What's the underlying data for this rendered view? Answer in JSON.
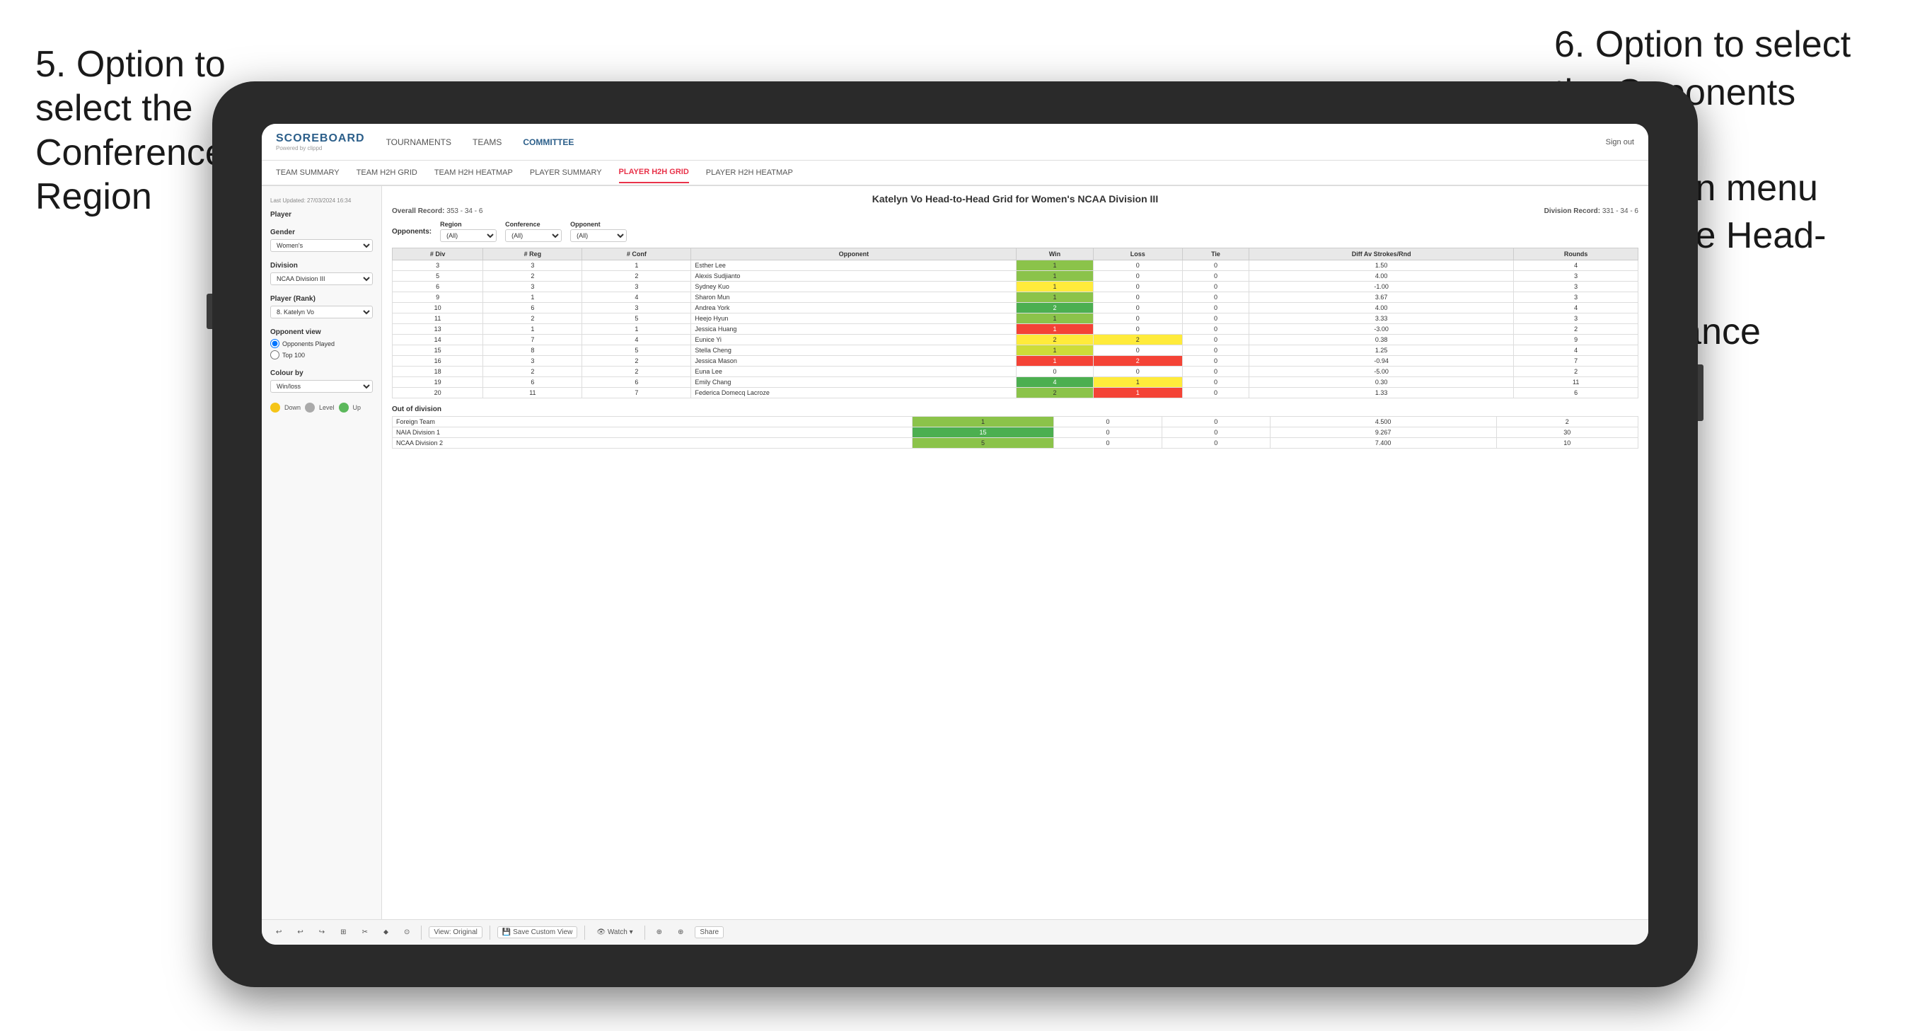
{
  "annotations": {
    "left": {
      "number": "5.",
      "text": "Option to\nselect the\nConference and\nRegion"
    },
    "right": {
      "number": "6.",
      "text": "Option to select\nthe Opponents\nfrom the\ndropdown menu\nto see the Head-\nto-Head\nperformance"
    }
  },
  "nav": {
    "logo": "SCOREBOARD",
    "logo_sub": "Powered by clippd",
    "items": [
      "TOURNAMENTS",
      "TEAMS",
      "COMMITTEE"
    ],
    "active_item": "COMMITTEE",
    "sign_out_label": "Sign out"
  },
  "sub_nav": {
    "items": [
      "TEAM SUMMARY",
      "TEAM H2H GRID",
      "TEAM H2H HEATMAP",
      "PLAYER SUMMARY",
      "PLAYER H2H GRID",
      "PLAYER H2H HEATMAP"
    ],
    "active_item": "PLAYER H2H GRID"
  },
  "sidebar": {
    "last_updated": "Last Updated: 27/03/2024 16:34",
    "player_label": "Player",
    "gender_label": "Gender",
    "gender_value": "Women's",
    "division_label": "Division",
    "division_value": "NCAA Division III",
    "player_rank_label": "Player (Rank)",
    "player_rank_value": "8. Katelyn Vo",
    "opponent_view_label": "Opponent view",
    "opponent_opponents": "Opponents Played",
    "opponent_top100": "Top 100",
    "colour_by_label": "Colour by",
    "colour_by_value": "Win/loss",
    "legend": [
      {
        "color": "#f5c518",
        "label": "Down"
      },
      {
        "color": "#aaaaaa",
        "label": "Level"
      },
      {
        "color": "#5cb85c",
        "label": "Up"
      }
    ]
  },
  "grid": {
    "title": "Katelyn Vo Head-to-Head Grid for Women's NCAA Division III",
    "overall_record_label": "Overall Record:",
    "overall_record": "353 - 34 - 6",
    "division_record_label": "Division Record:",
    "division_record": "331 - 34 - 6",
    "region_label": "Region",
    "conference_label": "Conference",
    "opponent_label": "Opponent",
    "opponents_label": "Opponents:",
    "region_value": "(All)",
    "conference_value": "(All)",
    "opponent_value": "(All)",
    "headers": [
      "# Div",
      "# Reg",
      "# Conf",
      "Opponent",
      "Win",
      "Loss",
      "Tie",
      "Diff Av Strokes/Rnd",
      "Rounds"
    ],
    "rows": [
      {
        "div": "3",
        "reg": "3",
        "conf": "1",
        "opponent": "Esther Lee",
        "win": "1",
        "loss": "0",
        "tie": "0",
        "diff": "1.50",
        "rounds": "4",
        "win_color": "green-mid",
        "loss_color": "white",
        "tie_color": "white"
      },
      {
        "div": "5",
        "reg": "2",
        "conf": "2",
        "opponent": "Alexis Sudjianto",
        "win": "1",
        "loss": "0",
        "tie": "0",
        "diff": "4.00",
        "rounds": "3",
        "win_color": "green-mid",
        "loss_color": "white",
        "tie_color": "white"
      },
      {
        "div": "6",
        "reg": "3",
        "conf": "3",
        "opponent": "Sydney Kuo",
        "win": "1",
        "loss": "0",
        "tie": "0",
        "diff": "-1.00",
        "rounds": "3",
        "win_color": "yellow",
        "loss_color": "white",
        "tie_color": "white"
      },
      {
        "div": "9",
        "reg": "1",
        "conf": "4",
        "opponent": "Sharon Mun",
        "win": "1",
        "loss": "0",
        "tie": "0",
        "diff": "3.67",
        "rounds": "3",
        "win_color": "green-mid",
        "loss_color": "white",
        "tie_color": "white"
      },
      {
        "div": "10",
        "reg": "6",
        "conf": "3",
        "opponent": "Andrea York",
        "win": "2",
        "loss": "0",
        "tie": "0",
        "diff": "4.00",
        "rounds": "4",
        "win_color": "green-dark",
        "loss_color": "white",
        "tie_color": "white"
      },
      {
        "div": "11",
        "reg": "2",
        "conf": "5",
        "opponent": "Heejo Hyun",
        "win": "1",
        "loss": "0",
        "tie": "0",
        "diff": "3.33",
        "rounds": "3",
        "win_color": "green-mid",
        "loss_color": "white",
        "tie_color": "white"
      },
      {
        "div": "13",
        "reg": "1",
        "conf": "1",
        "opponent": "Jessica Huang",
        "win": "1",
        "loss": "0",
        "tie": "0",
        "diff": "-3.00",
        "rounds": "2",
        "win_color": "red",
        "loss_color": "white",
        "tie_color": "white"
      },
      {
        "div": "14",
        "reg": "7",
        "conf": "4",
        "opponent": "Eunice Yi",
        "win": "2",
        "loss": "2",
        "tie": "0",
        "diff": "0.38",
        "rounds": "9",
        "win_color": "yellow",
        "loss_color": "yellow",
        "tie_color": "white"
      },
      {
        "div": "15",
        "reg": "8",
        "conf": "5",
        "opponent": "Stella Cheng",
        "win": "1",
        "loss": "0",
        "tie": "0",
        "diff": "1.25",
        "rounds": "4",
        "win_color": "green-light",
        "loss_color": "white",
        "tie_color": "white"
      },
      {
        "div": "16",
        "reg": "3",
        "conf": "2",
        "opponent": "Jessica Mason",
        "win": "1",
        "loss": "2",
        "tie": "0",
        "diff": "-0.94",
        "rounds": "7",
        "win_color": "red",
        "loss_color": "red",
        "tie_color": "white"
      },
      {
        "div": "18",
        "reg": "2",
        "conf": "2",
        "opponent": "Euna Lee",
        "win": "0",
        "loss": "0",
        "tie": "0",
        "diff": "-5.00",
        "rounds": "2",
        "win_color": "white",
        "loss_color": "white",
        "tie_color": "white"
      },
      {
        "div": "19",
        "reg": "6",
        "conf": "6",
        "opponent": "Emily Chang",
        "win": "4",
        "loss": "1",
        "tie": "0",
        "diff": "0.30",
        "rounds": "11",
        "win_color": "green-dark",
        "loss_color": "yellow",
        "tie_color": "white"
      },
      {
        "div": "20",
        "reg": "11",
        "conf": "7",
        "opponent": "Federica Domecq Lacroze",
        "win": "2",
        "loss": "1",
        "tie": "0",
        "diff": "1.33",
        "rounds": "6",
        "win_color": "green-mid",
        "loss_color": "red",
        "tie_color": "white"
      }
    ],
    "out_of_division_label": "Out of division",
    "out_of_division_rows": [
      {
        "opponent": "Foreign Team",
        "win": "1",
        "loss": "0",
        "tie": "0",
        "diff": "4.500",
        "rounds": "2",
        "win_color": "green-mid"
      },
      {
        "opponent": "NAIA Division 1",
        "win": "15",
        "loss": "0",
        "tie": "0",
        "diff": "9.267",
        "rounds": "30",
        "win_color": "green-dark"
      },
      {
        "opponent": "NCAA Division 2",
        "win": "5",
        "loss": "0",
        "tie": "0",
        "diff": "7.400",
        "rounds": "10",
        "win_color": "green-mid"
      }
    ]
  },
  "toolbar": {
    "items": [
      "↩",
      "↩",
      "↪",
      "⊞",
      "✂",
      "⬥",
      "⊙",
      "|",
      "View: Original",
      "|",
      "Save Custom View",
      "|",
      "Watch ▾",
      "|",
      "⊕",
      "⊕",
      "Share"
    ]
  }
}
